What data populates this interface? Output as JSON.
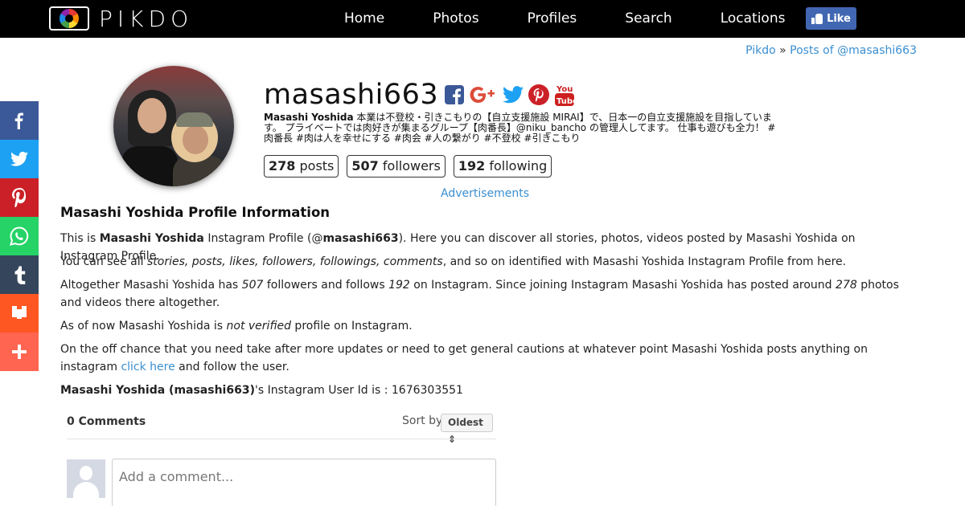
{
  "nav": {
    "logo_text": "PIKDO",
    "links": [
      "Home",
      "Photos",
      "Profiles",
      "Search",
      "Locations"
    ],
    "like_label": "Like"
  },
  "breadcrumb": {
    "home": "Pikdo",
    "separator": "»",
    "current": "Posts of @masashi663"
  },
  "share": [
    {
      "name": "facebook",
      "glyph": "f",
      "color": "#3b5998"
    },
    {
      "name": "twitter",
      "glyph": "t",
      "color": "#1da1f2"
    },
    {
      "name": "pinterest",
      "glyph": "P",
      "color": "#cb2027"
    },
    {
      "name": "whatsapp",
      "glyph": "w",
      "color": "#25d366"
    },
    {
      "name": "tumblr",
      "glyph": "t",
      "color": "#35465c"
    },
    {
      "name": "mix",
      "glyph": "m",
      "color": "#ff5722"
    },
    {
      "name": "more",
      "glyph": "+",
      "color": "#ff6550"
    }
  ],
  "profile": {
    "username": "masashi663",
    "bio_name": "Masashi Yoshida",
    "bio_text": " 本業は不登校・引きこもりの【自立支援施設 MIRAI】で、日本一の自立支援施設を目指しています。 プライベートでは肉好きが集まるグループ【肉番長】@niku_bancho の管理人してます。 仕事も遊びも全力！ #肉番長 #肉は人を幸せにする #肉会 #人の繋がり #不登校 #引きこもり",
    "posts_count": "278",
    "posts_label": "posts",
    "followers_count": "507",
    "followers_label": "followers",
    "following_count": "192",
    "following_label": "following",
    "icons": [
      "facebook-icon",
      "google-plus-icon",
      "twitter-icon",
      "pinterest-icon",
      "youtube-icon"
    ]
  },
  "ads_label": "Advertisements",
  "info": {
    "title": "Masashi Yoshida Profile Information",
    "p1_a": "This is ",
    "p1_name": "Masashi Yoshida",
    "p1_b": " Instagram Profile (@",
    "p1_user": "masashi663",
    "p1_c": "). Here you can discover all stories, photos, videos posted by Masashi Yoshida on Instagram Profile.",
    "p2_a": "You can see all ",
    "p2_em": "stories, posts, likes, followers, followings, comments",
    "p2_b": ", and so on identified with Masashi Yoshida Instagram Profile from here.",
    "p3_a": "Altogether Masashi Yoshida has ",
    "p3_followers": "507",
    "p3_b": " followers and follows ",
    "p3_following": "192",
    "p3_c": " on Instagram. Since joining Instagram Masashi Yoshida has posted around ",
    "p3_posts": "278",
    "p3_d": " photos and videos there altogether.",
    "p4_a": "As of now Masashi Yoshida is ",
    "p4_em": "not verified",
    "p4_b": " profile on Instagram.",
    "p5_a": "On the off chance that you need take after more updates or need to get general cautions at whatever point Masashi Yoshida posts anything on instagram ",
    "p5_link": "click here",
    "p5_b": " and follow the user.",
    "p6_name": "Masashi Yoshida (masashi663)",
    "p6_b": "'s Instagram User Id is : 1676303551"
  },
  "comments": {
    "count_label": "0 Comments",
    "sort_label": "Sort by",
    "sort_value": "Oldest ⇕",
    "placeholder": "Add a comment..."
  }
}
